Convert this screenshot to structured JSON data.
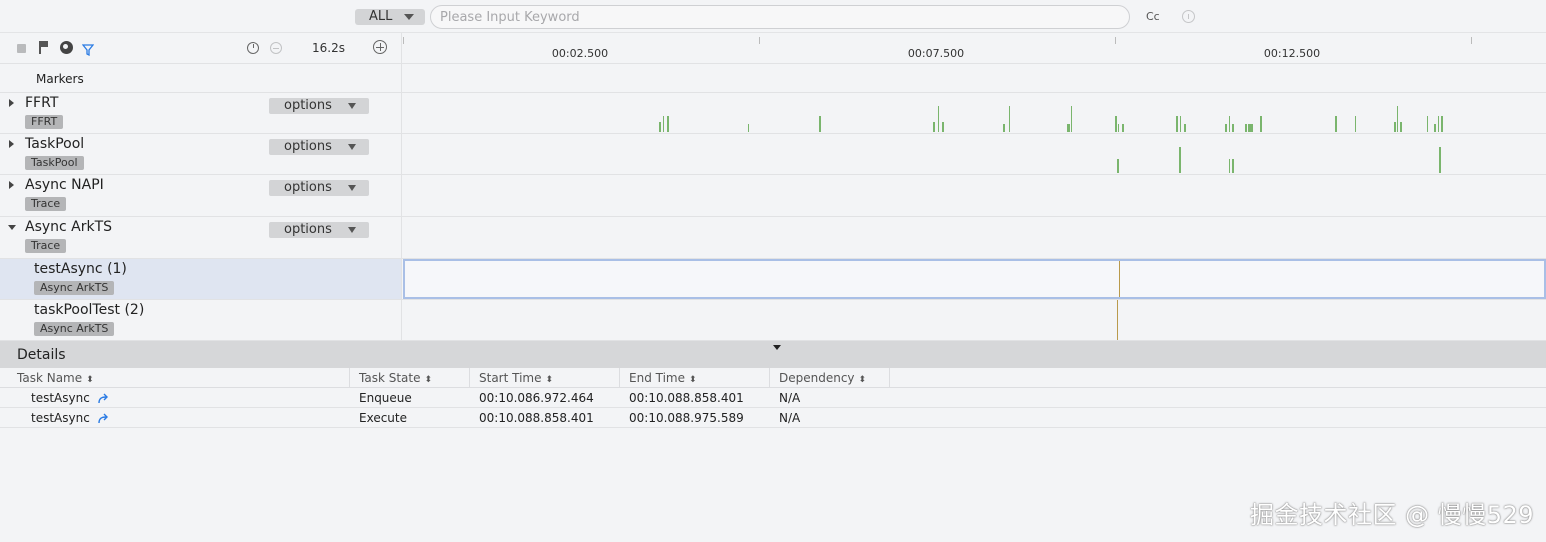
{
  "search": {
    "scope": "ALL",
    "placeholder": "Please Input Keyword",
    "value": "",
    "case_label": "Cc"
  },
  "toolbar": {
    "zoom_span": "16.2s",
    "icons": [
      "stop-square-icon",
      "flag-icon",
      "globe-icon",
      "filter-icon",
      "timer-icon",
      "zoom-out-icon",
      "zoom-in-icon"
    ]
  },
  "timeline": {
    "tick_labels": [
      "00:02.500",
      "00:07.500",
      "00:12.500"
    ]
  },
  "markers_label": "Markers",
  "groups": [
    {
      "name": "FFRT",
      "tag": "FFRT",
      "options": "options",
      "expanded": false
    },
    {
      "name": "TaskPool",
      "tag": "TaskPool",
      "options": "options",
      "expanded": false
    },
    {
      "name": "Async NAPI",
      "tag": "Trace",
      "options": "options",
      "expanded": false
    },
    {
      "name": "Async ArkTS",
      "tag": "Trace",
      "options": "options",
      "expanded": true
    }
  ],
  "subrows": [
    {
      "name": "testAsync (1)",
      "tag": "Async ArkTS",
      "selected": true
    },
    {
      "name": "taskPoolTest (2)",
      "tag": "Async ArkTS",
      "selected": false
    }
  ],
  "details": {
    "title": "Details",
    "columns": [
      "Task Name",
      "Task State",
      "Start Time",
      "End Time",
      "Dependency"
    ],
    "rows": [
      {
        "task_name": "testAsync",
        "task_state": "Enqueue",
        "start_time": "00:10.086.972.464",
        "end_time": "00:10.088.858.401",
        "dependency": "N/A"
      },
      {
        "task_name": "testAsync",
        "task_state": "Execute",
        "start_time": "00:10.088.858.401",
        "end_time": "00:10.088.975.589",
        "dependency": "N/A"
      }
    ]
  },
  "watermark": "掘金技术社区 @ 慢慢529",
  "colors": {
    "ffrt_bar": "#7ab56d",
    "async_marker": "#b99a4c",
    "selection": "#a9bfe6"
  }
}
